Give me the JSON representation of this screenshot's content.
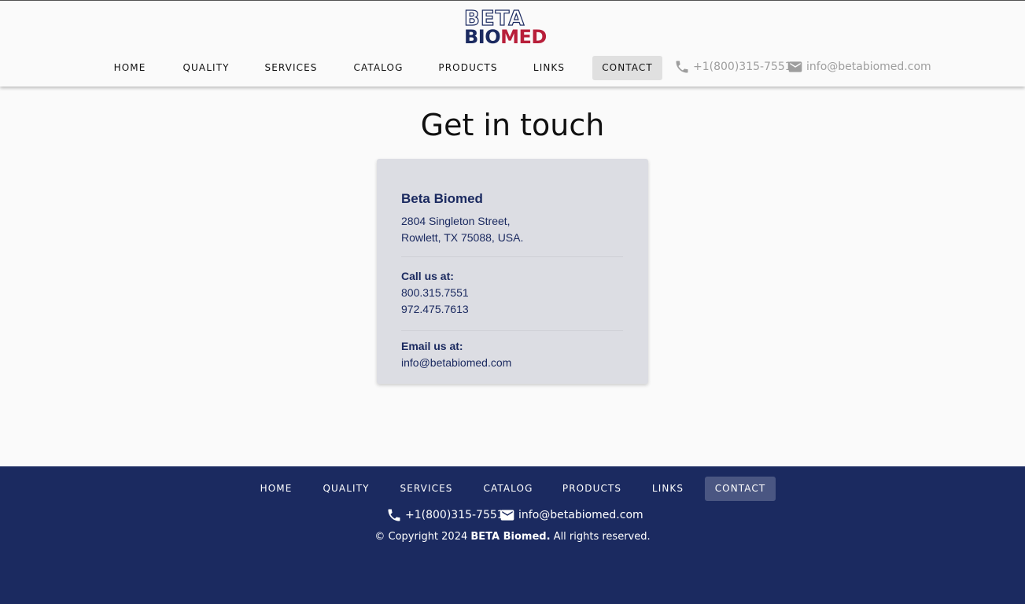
{
  "brand": {
    "top": "BETA",
    "bottom_a": "BIO",
    "bottom_b": "MED"
  },
  "nav": {
    "items": [
      {
        "label": "HOME"
      },
      {
        "label": "QUALITY"
      },
      {
        "label": "SERVICES"
      },
      {
        "label": "CATALOG"
      },
      {
        "label": "PRODUCTS"
      },
      {
        "label": "LINKS"
      },
      {
        "label": "CONTACT"
      }
    ],
    "active": "CONTACT"
  },
  "header_contact": {
    "phone": "+1(800)315-7551",
    "email": "info@betabiomed.com"
  },
  "main": {
    "title": "Get in touch",
    "card": {
      "company": "Beta Biomed",
      "address_line1": "2804 Singleton Street,",
      "address_line2": "Rowlett, TX 75088, USA.",
      "call_label": "Call us at:",
      "phone1": "800.315.7551",
      "phone2": "972.475.7613",
      "email_label": "Email us at:",
      "email": "info@betabiomed.com"
    }
  },
  "footer": {
    "phone": "+1(800)315-7551",
    "email": "info@betabiomed.com",
    "copy_prefix": "© Copyright 2024",
    "copy_brand": "BETA Biomed.",
    "copy_suffix": "All rights reserved."
  },
  "colors": {
    "navy": "#1b2a60",
    "red": "#b81f3a",
    "card_bg": "#dcdde3",
    "active_nav_bg": "#e0e0e0",
    "footer_active_bg": "#4a5682"
  },
  "icons": [
    "phone-icon",
    "email-icon"
  ]
}
